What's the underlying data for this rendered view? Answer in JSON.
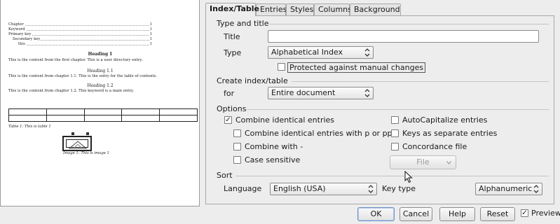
{
  "preview": {
    "toc": [
      {
        "text": "Chapter",
        "page": "1"
      },
      {
        "text": "Keyword",
        "page": "1"
      },
      {
        "text": "Primary key",
        "page": "1"
      },
      {
        "text": "Secondary key",
        "page": "1"
      },
      {
        "text": "this",
        "page": "1"
      }
    ],
    "heading1": "Heading 1",
    "text1": "This is the content from the first chapter. This is a user directory entry.",
    "heading11": "Heading 1.1",
    "text11": "This is the content from chapter 1.1. This is the entry for the table of contents.",
    "heading12": "Heading 1.2",
    "text12": "This is the content from chapter 1.2. This keyword is a main entry.",
    "table_caption": "Table 1: This is table 1",
    "image_caption": "Image 1: This is image 1"
  },
  "tabs": [
    "Index/Table",
    "Entries",
    "Styles",
    "Columns",
    "Background"
  ],
  "type_and_title": {
    "section": "Type and title",
    "title_label": "Title",
    "title_value": "",
    "type_label": "Type",
    "type_value": "Alphabetical Index",
    "protected_label": "Protected against manual changes",
    "protected_checked": false
  },
  "create_index": {
    "section": "Create index/table",
    "for_label": "for",
    "for_value": "Entire document"
  },
  "options": {
    "section": "Options",
    "combine_identical": "Combine identical entries",
    "combine_pp": "Combine identical entries with p or pp",
    "combine_with": "Combine with -",
    "case_sensitive": "Case sensitive",
    "autocapitalize": "AutoCapitalize entries",
    "keys_separate": "Keys as separate entries",
    "concordance": "Concordance file",
    "file_button": "File"
  },
  "sort": {
    "section": "Sort",
    "language_label": "Language",
    "language_value": "English (USA)",
    "key_type_label": "Key type",
    "key_type_value": "Alphanumeric"
  },
  "buttons": {
    "ok": "OK",
    "cancel": "Cancel",
    "help": "Help",
    "reset": "Reset",
    "preview": "Preview",
    "preview_checked": true
  },
  "check_mark": "✓"
}
